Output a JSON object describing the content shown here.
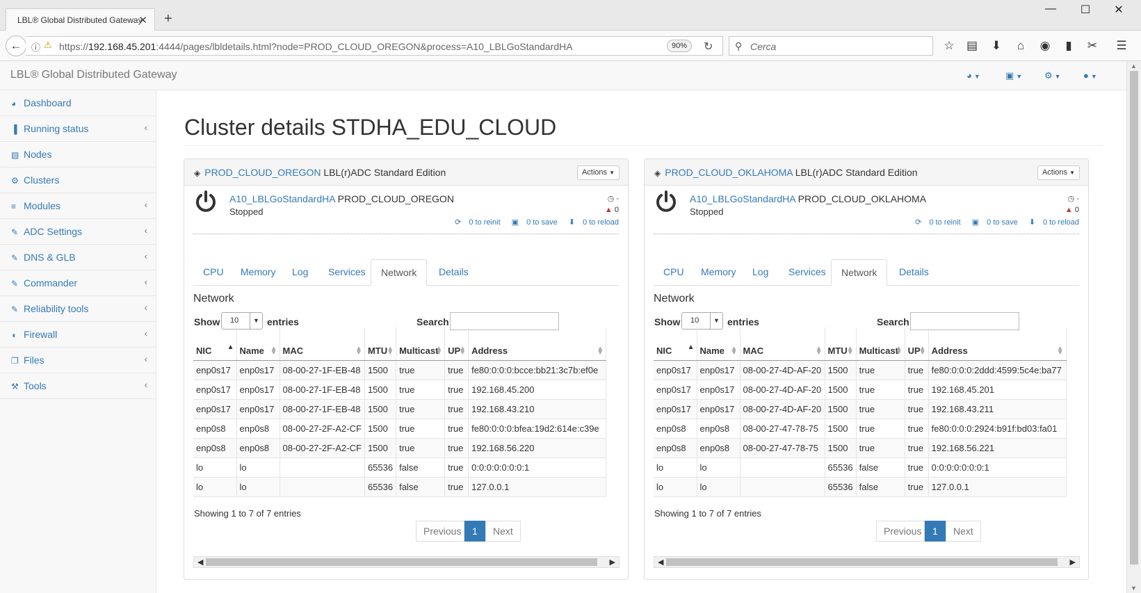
{
  "browser": {
    "tab_title": "LBL® Global Distributed Gateway",
    "url_prefix": "https://",
    "url_host": "192.168.45.201",
    "url_rest": ":4444/pages/lbldetails.html?node=PROD_CLOUD_OREGON&process=A10_LBLGoStandardHA",
    "zoom": "90%",
    "search_placeholder": "Cerca"
  },
  "app": {
    "brand": "LBL® Global Distributed Gateway"
  },
  "sidebar": {
    "items": [
      {
        "label": "Dashboard",
        "icon": "dashboard-icon",
        "glyph": "◕",
        "expandable": false
      },
      {
        "label": "Running status",
        "icon": "bar-chart-icon",
        "glyph": "▐",
        "expandable": true
      },
      {
        "label": "Nodes",
        "icon": "cube-icon",
        "glyph": "▧",
        "expandable": false
      },
      {
        "label": "Clusters",
        "icon": "cogs-icon",
        "glyph": "⚙",
        "expandable": false
      },
      {
        "label": "Modules",
        "icon": "list-icon",
        "glyph": "≡",
        "expandable": true
      },
      {
        "label": "ADC Settings",
        "icon": "edit-icon",
        "glyph": "✎",
        "expandable": true
      },
      {
        "label": "DNS & GLB",
        "icon": "edit-icon",
        "glyph": "✎",
        "expandable": true
      },
      {
        "label": "Commander",
        "icon": "edit-icon",
        "glyph": "✎",
        "expandable": true
      },
      {
        "label": "Reliability tools",
        "icon": "edit-icon",
        "glyph": "✎",
        "expandable": true
      },
      {
        "label": "Firewall",
        "icon": "shield-icon",
        "glyph": "◖",
        "expandable": true
      },
      {
        "label": "Files",
        "icon": "files-icon",
        "glyph": "❐",
        "expandable": true
      },
      {
        "label": "Tools",
        "icon": "wrench-icon",
        "glyph": "⚒",
        "expandable": true
      }
    ]
  },
  "page": {
    "title": "Cluster details STDHA_EDU_CLOUD"
  },
  "table_headers": [
    "NIC",
    "Name",
    "MAC",
    "MTU",
    "Multicast",
    "UP",
    "Address"
  ],
  "panels": [
    {
      "node": "PROD_CLOUD_OREGON",
      "edition": "LBL(r)ADC Standard Edition",
      "actions": "Actions",
      "process": "A10_LBLGoStandardHA",
      "process_node": "PROD_CLOUD_OREGON",
      "status": "Stopped",
      "uptime": "-",
      "warnings": "0",
      "to_reinit": "0 to reinit",
      "to_save": "0 to save",
      "to_reload": "0 to reload",
      "tabs": [
        "CPU",
        "Memory",
        "Log",
        "Services",
        "Network",
        "Details"
      ],
      "section": "Network",
      "show": "Show",
      "page_size": "10",
      "entries": "entries",
      "search_label": "Search:",
      "rows": [
        [
          "enp0s17",
          "enp0s17",
          "08-00-27-1F-EB-48",
          "1500",
          "true",
          "true",
          "fe80:0:0:0:bcce:bb21:3c7b:ef0e"
        ],
        [
          "enp0s17",
          "enp0s17",
          "08-00-27-1F-EB-48",
          "1500",
          "true",
          "true",
          "192.168.45.200"
        ],
        [
          "enp0s17",
          "enp0s17",
          "08-00-27-1F-EB-48",
          "1500",
          "true",
          "true",
          "192.168.43.210"
        ],
        [
          "enp0s8",
          "enp0s8",
          "08-00-27-2F-A2-CF",
          "1500",
          "true",
          "true",
          "fe80:0:0:0:bfea:19d2:614e:c39e"
        ],
        [
          "enp0s8",
          "enp0s8",
          "08-00-27-2F-A2-CF",
          "1500",
          "true",
          "true",
          "192.168.56.220"
        ],
        [
          "lo",
          "lo",
          "",
          "65536",
          "false",
          "true",
          "0:0:0:0:0:0:0:1"
        ],
        [
          "lo",
          "lo",
          "",
          "65536",
          "false",
          "true",
          "127.0.0.1"
        ]
      ],
      "info": "Showing 1 to 7 of 7 entries",
      "prev": "Previous",
      "page": "1",
      "next": "Next"
    },
    {
      "node": "PROD_CLOUD_OKLAHOMA",
      "edition": "LBL(r)ADC Standard Edition",
      "actions": "Actions",
      "process": "A10_LBLGoStandardHA",
      "process_node": "PROD_CLOUD_OKLAHOMA",
      "status": "Stopped",
      "uptime": "-",
      "warnings": "0",
      "to_reinit": "0 to reinit",
      "to_save": "0 to save",
      "to_reload": "0 to reload",
      "tabs": [
        "CPU",
        "Memory",
        "Log",
        "Services",
        "Network",
        "Details"
      ],
      "section": "Network",
      "show": "Show",
      "page_size": "10",
      "entries": "entries",
      "search_label": "Search:",
      "rows": [
        [
          "enp0s17",
          "enp0s17",
          "08-00-27-4D-AF-20",
          "1500",
          "true",
          "true",
          "fe80:0:0:0:2ddd:4599:5c4e:ba77"
        ],
        [
          "enp0s17",
          "enp0s17",
          "08-00-27-4D-AF-20",
          "1500",
          "true",
          "true",
          "192.168.45.201"
        ],
        [
          "enp0s17",
          "enp0s17",
          "08-00-27-4D-AF-20",
          "1500",
          "true",
          "true",
          "192.168.43.211"
        ],
        [
          "enp0s8",
          "enp0s8",
          "08-00-27-47-78-75",
          "1500",
          "true",
          "true",
          "fe80:0:0:0:2924:b91f:bd03:fa01"
        ],
        [
          "enp0s8",
          "enp0s8",
          "08-00-27-47-78-75",
          "1500",
          "true",
          "true",
          "192.168.56.221"
        ],
        [
          "lo",
          "lo",
          "",
          "65536",
          "false",
          "true",
          "0:0:0:0:0:0:0:1"
        ],
        [
          "lo",
          "lo",
          "",
          "65536",
          "false",
          "true",
          "127.0.0.1"
        ]
      ],
      "info": "Showing 1 to 7 of 7 entries",
      "prev": "Previous",
      "page": "1",
      "next": "Next"
    }
  ],
  "colors": {
    "link": "#337ab7",
    "warning": "#c0392b"
  }
}
